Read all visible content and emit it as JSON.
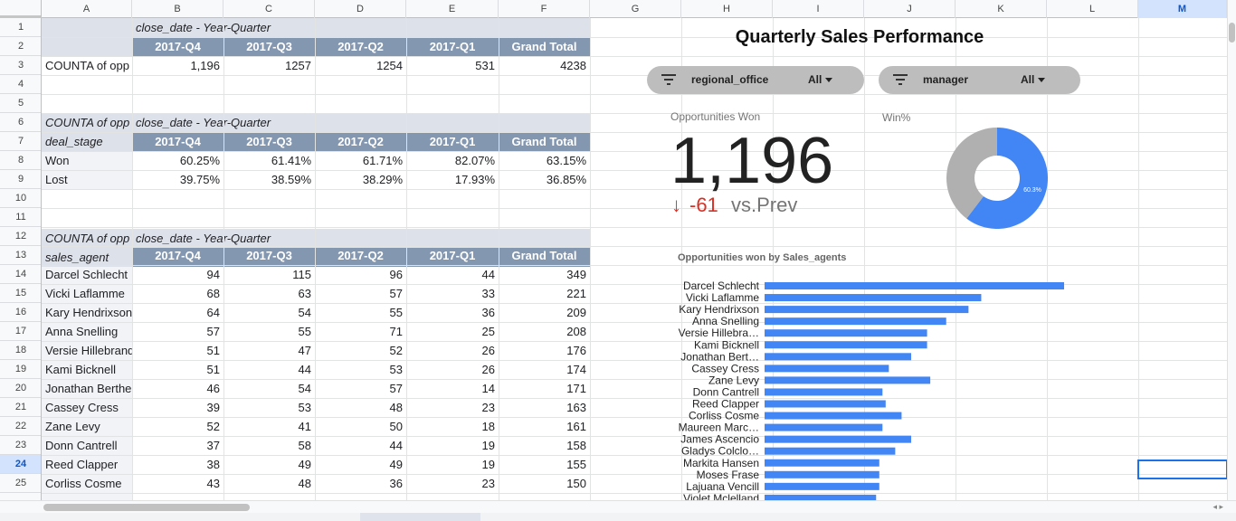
{
  "columns": [
    "A",
    "B",
    "C",
    "D",
    "E",
    "F",
    "G",
    "H",
    "I",
    "J",
    "K",
    "L",
    "M"
  ],
  "selected_column": "M",
  "rows": [
    "1",
    "2",
    "3",
    "4",
    "5",
    "6",
    "7",
    "8",
    "9",
    "10",
    "11",
    "12",
    "13",
    "14",
    "15",
    "16",
    "17",
    "18",
    "19",
    "20",
    "21",
    "22",
    "23",
    "24",
    "25"
  ],
  "selected_row": "24",
  "pivot1": {
    "col_field": "close_date - Year-Quarter",
    "headers": [
      "2017-Q4",
      "2017-Q3",
      "2017-Q2",
      "2017-Q1",
      "Grand Total"
    ],
    "row_label": "COUNTA of opp",
    "values": [
      "1,196",
      "1257",
      "1254",
      "531",
      "4238"
    ]
  },
  "pivot2": {
    "value_field": "COUNTA of opp",
    "col_field": "close_date - Year-Quarter",
    "row_field": "deal_stage",
    "headers": [
      "2017-Q4",
      "2017-Q3",
      "2017-Q2",
      "2017-Q1",
      "Grand Total"
    ],
    "rows": [
      {
        "label": "Won",
        "values": [
          "60.25%",
          "61.41%",
          "61.71%",
          "82.07%",
          "63.15%"
        ]
      },
      {
        "label": "Lost",
        "values": [
          "39.75%",
          "38.59%",
          "38.29%",
          "17.93%",
          "36.85%"
        ]
      }
    ]
  },
  "pivot3": {
    "value_field": "COUNTA of opp",
    "col_field": "close_date - Year-Quarter",
    "row_field": "sales_agent",
    "headers": [
      "2017-Q4",
      "2017-Q3",
      "2017-Q2",
      "2017-Q1",
      "Grand Total"
    ],
    "rows": [
      {
        "label": "Darcel Schlecht",
        "values": [
          "94",
          "115",
          "96",
          "44",
          "349"
        ]
      },
      {
        "label": "Vicki Laflamme",
        "values": [
          "68",
          "63",
          "57",
          "33",
          "221"
        ]
      },
      {
        "label": "Kary Hendrixson",
        "values": [
          "64",
          "54",
          "55",
          "36",
          "209"
        ]
      },
      {
        "label": "Anna Snelling",
        "values": [
          "57",
          "55",
          "71",
          "25",
          "208"
        ]
      },
      {
        "label": "Versie Hillebrand",
        "values": [
          "51",
          "47",
          "52",
          "26",
          "176"
        ]
      },
      {
        "label": "Kami Bicknell",
        "values": [
          "51",
          "44",
          "53",
          "26",
          "174"
        ]
      },
      {
        "label": "Jonathan Berthelot",
        "values": [
          "46",
          "54",
          "57",
          "14",
          "171"
        ]
      },
      {
        "label": "Cassey Cress",
        "values": [
          "39",
          "53",
          "48",
          "23",
          "163"
        ]
      },
      {
        "label": "Zane Levy",
        "values": [
          "52",
          "41",
          "50",
          "18",
          "161"
        ]
      },
      {
        "label": "Donn Cantrell",
        "values": [
          "37",
          "58",
          "44",
          "19",
          "158"
        ]
      },
      {
        "label": "Reed Clapper",
        "values": [
          "38",
          "49",
          "49",
          "19",
          "155"
        ]
      },
      {
        "label": "Corliss Cosme",
        "values": [
          "43",
          "48",
          "36",
          "23",
          "150"
        ]
      }
    ]
  },
  "dashboard": {
    "title": "Quarterly Sales Performance",
    "filters": [
      {
        "label": "regional_office",
        "value": "All"
      },
      {
        "label": "manager",
        "value": "All"
      }
    ],
    "kpi": {
      "label": "Opportunities Won",
      "value": "1,196",
      "arrow": "↓",
      "delta": "-61",
      "comparison": "vs.Prev"
    },
    "win_label": "Win%",
    "bar_title": "Opportunities won by Sales_agents"
  },
  "colors": {
    "pivot_header": "#8497b0",
    "pivot_subheader": "#dde1ea",
    "chart_blue": "#4285f4",
    "donut_grey": "#b0b0b0",
    "negative": "#d93025"
  },
  "chart_data": [
    {
      "type": "pie",
      "title": "",
      "labels": [
        "Won",
        ""
      ],
      "values": [
        60.3,
        39.7
      ],
      "slice_label": "60.3%",
      "donut": true
    },
    {
      "type": "bar",
      "orientation": "horizontal",
      "title": "Opportunities won by Sales_agents",
      "categories": [
        "Darcel Schlecht",
        "Vicki Laflamme",
        "Kary Hendrixson",
        "Anna Snelling",
        "Versie Hillebra…",
        "Kami Bicknell",
        "Jonathan Bert…",
        "Cassey Cress",
        "Zane Levy",
        "Donn Cantrell",
        "Reed Clapper",
        "Corliss Cosme",
        "Maureen Marc…",
        "James Ascencio",
        "Gladys Colclo…",
        "Markita Hansen",
        "Moses Frase",
        "Lajuana Vencill",
        "Violet Mclelland"
      ],
      "values": [
        94,
        68,
        64,
        57,
        51,
        51,
        46,
        39,
        52,
        37,
        38,
        43,
        37,
        46,
        41,
        36,
        36,
        36,
        35
      ],
      "xlim": [
        0,
        100
      ]
    }
  ]
}
